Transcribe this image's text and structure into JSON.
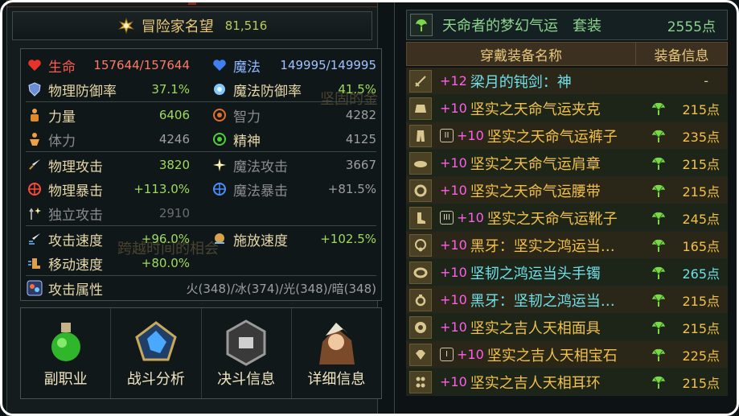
{
  "left_panel": {
    "reputation": {
      "label": "冒险家名望",
      "value": "81,516"
    },
    "stats": [
      {
        "icon": "heart-icon",
        "label": "生命",
        "value": "157644/157644",
        "style": "red"
      },
      {
        "icon": "mana-heart-icon",
        "label": "魔法",
        "value": "149995/149995",
        "style": "blue"
      },
      {
        "icon": "shield-icon",
        "label": "物理防御率",
        "value": "37.1%"
      },
      {
        "icon": "magic-orb-icon",
        "label": "魔法防御率",
        "value": "41.5%"
      },
      {
        "icon": "strength-icon",
        "label": "力量",
        "value": "6406"
      },
      {
        "icon": "intellect-icon",
        "label": "智力",
        "value": "4282"
      },
      {
        "icon": "vitality-icon",
        "label": "体力",
        "value": "4246"
      },
      {
        "icon": "spirit-icon",
        "label": "精神",
        "value": "4125"
      },
      {
        "icon": "sword-icon",
        "label": "物理攻击",
        "value": "3820"
      },
      {
        "icon": "magic-attack-icon",
        "label": "魔法攻击",
        "value": "3667"
      },
      {
        "icon": "physical-crit-icon",
        "label": "物理暴击",
        "value": "+113.0%"
      },
      {
        "icon": "magic-crit-icon",
        "label": "魔法暴击",
        "value": "+81.5%"
      },
      {
        "icon": "independent-attack-icon",
        "label": "独立攻击",
        "value": "2910"
      },
      {
        "icon": "attack-speed-icon",
        "label": "攻击速度",
        "value": "+96.0%"
      },
      {
        "icon": "cast-speed-icon",
        "label": "施放速度",
        "value": "+102.5%"
      },
      {
        "icon": "move-speed-icon",
        "label": "移动速度",
        "value": "+80.0%"
      },
      {
        "icon": "element-icon",
        "label": "攻击属性",
        "value": "火(348)/冰(374)/光(348)/暗(348)"
      }
    ],
    "ghost_texts": [
      "跨越时间的相会",
      "坚固的金"
    ],
    "buttons": [
      {
        "label": "副职业",
        "icon": "potion-icon"
      },
      {
        "label": "战斗分析",
        "icon": "pentagon-chart-icon"
      },
      {
        "label": "决斗信息",
        "icon": "duel-emblem-icon"
      },
      {
        "label": "详细信息",
        "icon": "character-portrait-icon"
      }
    ]
  },
  "right_panel": {
    "set": {
      "name": "天命者的梦幻气运　套装",
      "points": "2555点"
    },
    "columns": {
      "name": "穿戴装备名称",
      "info": "装备信息"
    },
    "equipment": [
      {
        "slot_icon": "weapon-slot-icon",
        "badge": "",
        "plus": "+12",
        "name": "梁月的钝剑：神",
        "name_color": "cyan",
        "leaf": false,
        "points": "-"
      },
      {
        "slot_icon": "coat-slot-icon",
        "badge": "",
        "plus": "+10",
        "name": "坚实之天命气运夹克",
        "name_color": "gold",
        "leaf": true,
        "points": "215点"
      },
      {
        "slot_icon": "pants-slot-icon",
        "badge": "II",
        "plus": "+10",
        "name": "坚实之天命气运裤子",
        "name_color": "gold",
        "leaf": true,
        "points": "235点"
      },
      {
        "slot_icon": "shoulder-slot-icon",
        "badge": "",
        "plus": "+10",
        "name": "坚实之天命气运肩章",
        "name_color": "gold",
        "leaf": true,
        "points": "215点"
      },
      {
        "slot_icon": "belt-slot-icon",
        "badge": "",
        "plus": "+10",
        "name": "坚实之天命气运腰带",
        "name_color": "gold",
        "leaf": true,
        "points": "215点"
      },
      {
        "slot_icon": "boots-slot-icon",
        "badge": "III",
        "plus": "+10",
        "name": "坚实之天命气运靴子",
        "name_color": "gold",
        "leaf": true,
        "points": "245点"
      },
      {
        "slot_icon": "necklace-slot-icon",
        "badge": "",
        "plus": "+10",
        "name": "黑牙：坚实之鸿运当…",
        "name_color": "gold",
        "leaf": true,
        "points": "165点"
      },
      {
        "slot_icon": "bracelet-slot-icon",
        "badge": "",
        "plus": "+10",
        "name": "坚韧之鸿运当头手镯",
        "name_color": "cyan",
        "leaf": true,
        "points": "265点",
        "points_color": "cyan"
      },
      {
        "slot_icon": "ring-slot-icon",
        "badge": "",
        "plus": "+10",
        "name": "黑牙：坚韧之鸿运当…",
        "name_color": "cyan",
        "leaf": true,
        "points": "215点"
      },
      {
        "slot_icon": "subequip-slot-icon",
        "badge": "",
        "plus": "+10",
        "name": "坚实之吉人天相面具",
        "name_color": "gold",
        "leaf": true,
        "points": "215点"
      },
      {
        "slot_icon": "gem-slot-icon",
        "badge": "I",
        "plus": "+10",
        "name": "坚实之吉人天相宝石",
        "name_color": "gold",
        "leaf": true,
        "points": "225点"
      },
      {
        "slot_icon": "earring-slot-icon",
        "badge": "",
        "plus": "+10",
        "name": "坚实之吉人天相耳环",
        "name_color": "gold",
        "leaf": true,
        "points": "215点"
      }
    ]
  }
}
